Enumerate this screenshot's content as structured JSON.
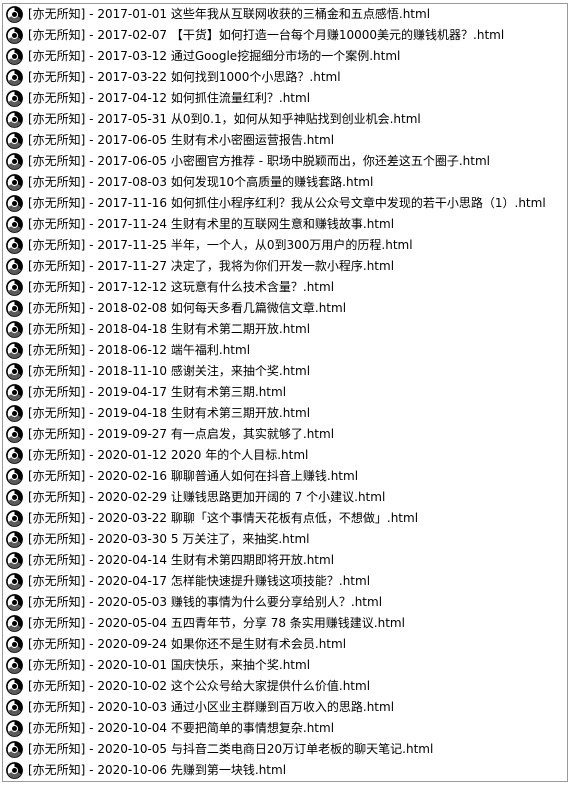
{
  "list": {
    "icon": "chrome-html-file-icon",
    "items": [
      "[亦无所知] - 2017-01-01 这些年我从互联网收获的三桶金和五点感悟.html",
      "[亦无所知] - 2017-02-07 【干货】如何打造一台每个月赚10000美元的赚钱机器？.html",
      "[亦无所知] - 2017-03-12 通过Google挖掘细分市场的一个案例.html",
      "[亦无所知] - 2017-03-22 如何找到1000个小思路？.html",
      "[亦无所知] - 2017-04-12 如何抓住流量红利？.html",
      "[亦无所知] - 2017-05-31 从0到0.1，如何从知乎神贴找到创业机会.html",
      "[亦无所知] - 2017-06-05 生财有术小密圈运营报告.html",
      "[亦无所知] - 2017-06-05 小密圈官方推荐 - 职场中脱颖而出，你还差这五个圈子.html",
      "[亦无所知] - 2017-08-03 如何发现10个高质量的赚钱套路.html",
      "[亦无所知] - 2017-11-16 如何抓住小程序红利？我从公众号文章中发现的若干小思路（1）.html",
      "[亦无所知] - 2017-11-24 生财有术里的互联网生意和赚钱故事.html",
      "[亦无所知] - 2017-11-25 半年，一个人，从0到300万用户的历程.html",
      "[亦无所知] - 2017-11-27 决定了，我将为你们开发一款小程序.html",
      "[亦无所知] - 2017-12-12 这玩意有什么技术含量？.html",
      "[亦无所知] - 2018-02-08 如何每天多看几篇微信文章.html",
      "[亦无所知] - 2018-04-18 生财有术第二期开放.html",
      "[亦无所知] - 2018-06-12 端午福利.html",
      "[亦无所知] - 2018-11-10 感谢关注，来抽个奖.html",
      "[亦无所知] - 2019-04-17 生财有术第三期.html",
      "[亦无所知] - 2019-04-18 生财有术第三期开放.html",
      "[亦无所知] - 2019-09-27 有一点启发，其实就够了.html",
      "[亦无所知] - 2020-01-12 2020 年的个人目标.html",
      "[亦无所知] - 2020-02-16 聊聊普通人如何在抖音上赚钱.html",
      "[亦无所知] - 2020-02-29 让赚钱思路更加开阔的 7 个小建议.html",
      "[亦无所知] - 2020-03-22 聊聊「这个事情天花板有点低，不想做」.html",
      "[亦无所知] - 2020-03-30 5 万关注了，来抽奖.html",
      "[亦无所知] - 2020-04-14 生财有术第四期即将开放.html",
      "[亦无所知] - 2020-04-17 怎样能快速提升赚钱这项技能？.html",
      "[亦无所知] - 2020-05-03 赚钱的事情为什么要分享给别人？.html",
      "[亦无所知] - 2020-05-04 五四青年节，分享 78 条实用赚钱建议.html",
      "[亦无所知] - 2020-09-24 如果你还不是生财有术会员.html",
      "[亦无所知] - 2020-10-01 国庆快乐，来抽个奖.html",
      "[亦无所知] - 2020-10-02 这个公众号给大家提供什么价值.html",
      "[亦无所知] - 2020-10-03 通过小区业主群赚到百万收入的思路.html",
      "[亦无所知] - 2020-10-04 不要把简单的事情想复杂.html",
      "[亦无所知] - 2020-10-05 与抖音二类电商日20万订单老板的聊天笔记.html",
      "[亦无所知] - 2020-10-06 先赚到第一块钱.html"
    ]
  }
}
